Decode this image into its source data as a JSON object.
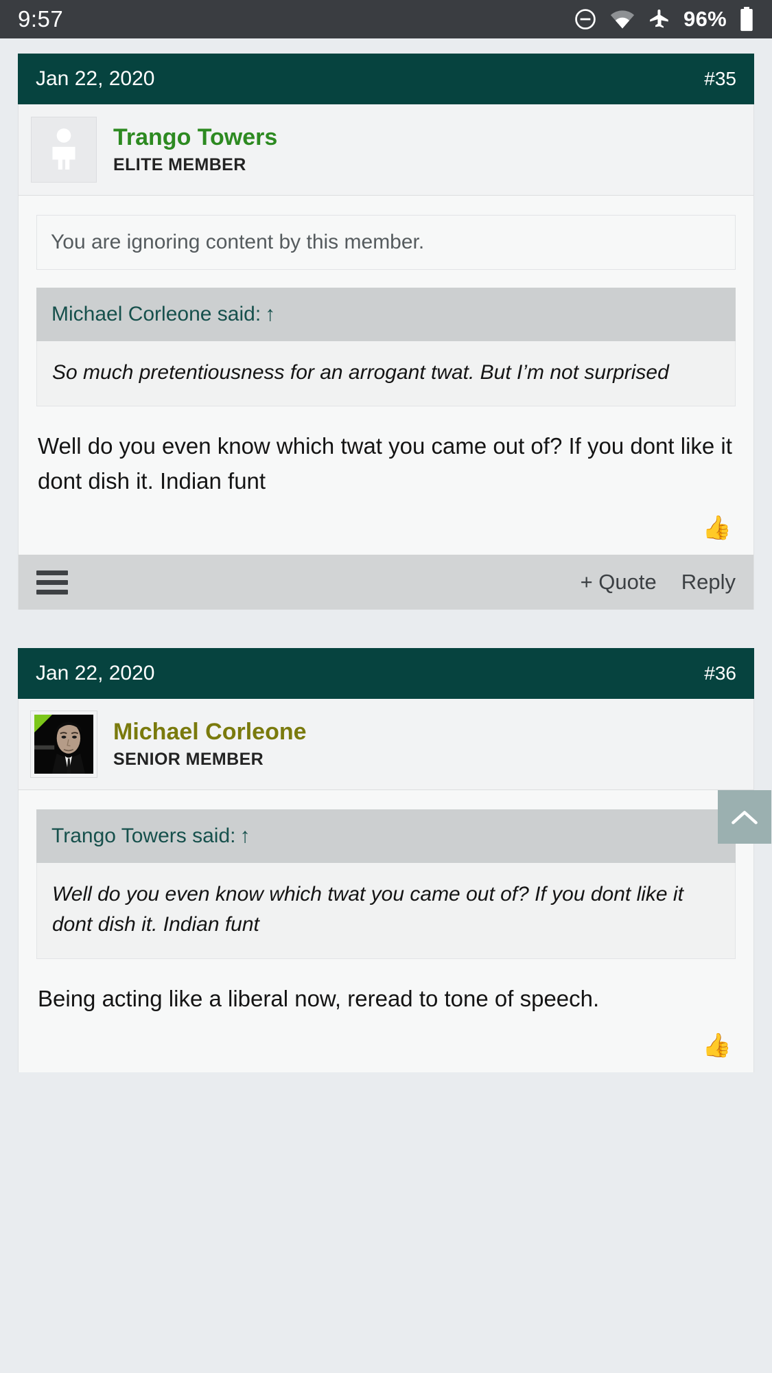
{
  "status_bar": {
    "time": "9:57",
    "battery_percent": "96%",
    "icons": [
      "do-not-disturb-icon",
      "wifi-icon",
      "airplane-mode-icon",
      "battery-icon"
    ]
  },
  "theme": {
    "header_bg": "#06433f",
    "quote_head_text": "#16504c",
    "username_green": "#2d8a21",
    "username_olive": "#7a7a0d",
    "badge_green": "#7cc61a",
    "action_bar_bg": "#d2d4d5",
    "page_bg": "#e9ecef",
    "status_bar_bg": "#3a3d41"
  },
  "posts": [
    {
      "date": "Jan 22, 2020",
      "number": "#35",
      "username": "Trango Towers",
      "user_title": "ELITE MEMBER",
      "avatar_type": "placeholder-person-icon",
      "ignore_notice": "You are ignoring content by this member.",
      "quote": {
        "attribution": "Michael Corleone said:",
        "arrow": "↑",
        "text": "So much pretentiousness for an arrogant twat. But I’m not surprised"
      },
      "body": "Well do you even know which twat you came out of? If you dont like it dont dish it. Indian funt",
      "reaction": "👍",
      "actions": {
        "quote_label": "+ Quote",
        "reply_label": "Reply",
        "menu": "hamburger-icon"
      }
    },
    {
      "date": "Jan 22, 2020",
      "number": "#36",
      "username": "Michael Corleone",
      "user_title": "SENIOR MEMBER",
      "avatar_type": "user-photo",
      "quote": {
        "attribution": "Trango Towers said:",
        "arrow": "↑",
        "text": "Well do you even know which twat you came out of? If you dont like it dont dish it. Indian funt"
      },
      "body": "Being acting like a liberal now, reread to tone of speech.",
      "reaction": "👍"
    }
  ],
  "scroll_to_top": {
    "icon": "chevron-up-icon"
  }
}
